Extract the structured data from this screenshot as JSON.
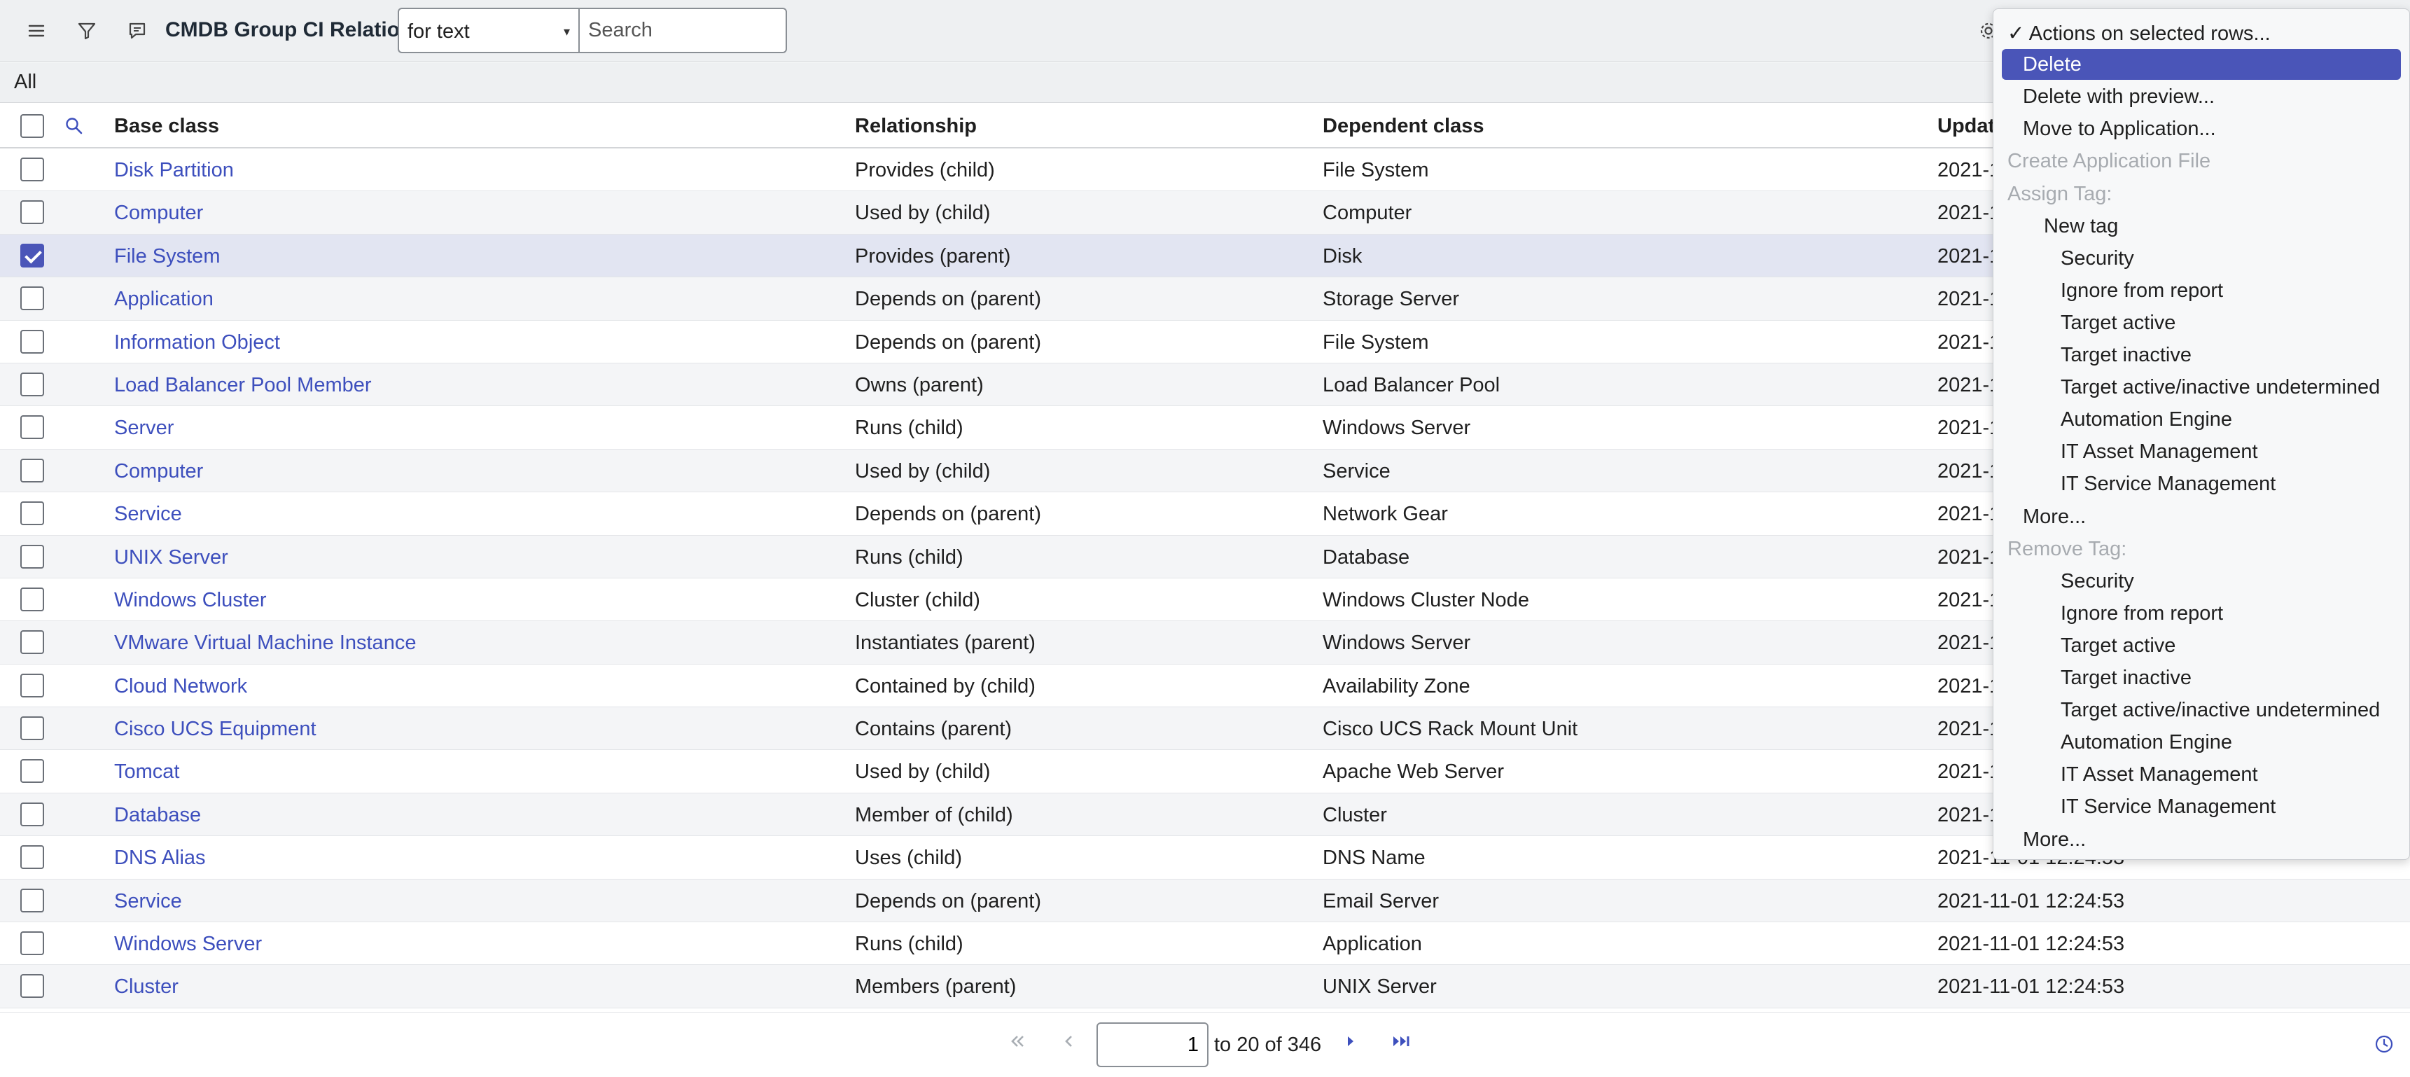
{
  "header": {
    "title": "CMDB Group CI Relations",
    "search_field": "for text",
    "search_placeholder": "Search"
  },
  "breadcrumb": "All",
  "columns": {
    "base": "Base class",
    "relationship": "Relationship",
    "dependent": "Dependent class",
    "updated": "Update"
  },
  "rows": [
    {
      "base": "Disk Partition",
      "rel": "Provides (child)",
      "dep": "File System",
      "upd": "2021-1",
      "selected": false
    },
    {
      "base": "Computer",
      "rel": "Used by (child)",
      "dep": "Computer",
      "upd": "2021-1",
      "selected": false
    },
    {
      "base": "File System",
      "rel": "Provides (parent)",
      "dep": "Disk",
      "upd": "2021-1",
      "selected": true
    },
    {
      "base": "Application",
      "rel": "Depends on (parent)",
      "dep": "Storage Server",
      "upd": "2021-1",
      "selected": false
    },
    {
      "base": "Information Object",
      "rel": "Depends on (parent)",
      "dep": "File System",
      "upd": "2021-1",
      "selected": false
    },
    {
      "base": "Load Balancer Pool Member",
      "rel": "Owns (parent)",
      "dep": "Load Balancer Pool",
      "upd": "2021-1",
      "selected": false
    },
    {
      "base": "Server",
      "rel": "Runs (child)",
      "dep": "Windows Server",
      "upd": "2021-1",
      "selected": false
    },
    {
      "base": "Computer",
      "rel": "Used by (child)",
      "dep": "Service",
      "upd": "2021-1",
      "selected": false
    },
    {
      "base": "Service",
      "rel": "Depends on (parent)",
      "dep": "Network Gear",
      "upd": "2021-1",
      "selected": false
    },
    {
      "base": "UNIX Server",
      "rel": "Runs (child)",
      "dep": "Database",
      "upd": "2021-1",
      "selected": false
    },
    {
      "base": "Windows Cluster",
      "rel": "Cluster (child)",
      "dep": "Windows Cluster Node",
      "upd": "2021-1",
      "selected": false
    },
    {
      "base": "VMware Virtual Machine Instance",
      "rel": "Instantiates (parent)",
      "dep": "Windows Server",
      "upd": "2021-1",
      "selected": false
    },
    {
      "base": "Cloud Network",
      "rel": "Contained by (child)",
      "dep": "Availability Zone",
      "upd": "2021-1",
      "selected": false
    },
    {
      "base": "Cisco UCS Equipment",
      "rel": "Contains (parent)",
      "dep": "Cisco UCS Rack Mount Unit",
      "upd": "2021-1",
      "selected": false
    },
    {
      "base": "Tomcat",
      "rel": "Used by (child)",
      "dep": "Apache Web Server",
      "upd": "2021-1",
      "selected": false
    },
    {
      "base": "Database",
      "rel": "Member of (child)",
      "dep": "Cluster",
      "upd": "2021-1",
      "selected": false
    },
    {
      "base": "DNS Alias",
      "rel": "Uses (child)",
      "dep": "DNS Name",
      "upd": "2021-11-01 12:24:53",
      "selected": false
    },
    {
      "base": "Service",
      "rel": "Depends on (parent)",
      "dep": "Email Server",
      "upd": "2021-11-01 12:24:53",
      "selected": false
    },
    {
      "base": "Windows Server",
      "rel": "Runs (child)",
      "dep": "Application",
      "upd": "2021-11-01 12:24:53",
      "selected": false
    },
    {
      "base": "Cluster",
      "rel": "Members (parent)",
      "dep": "UNIX Server",
      "upd": "2021-11-01 12:24:53",
      "selected": false
    }
  ],
  "pagination": {
    "page_value": "1",
    "range_text": "to 20 of 346"
  },
  "menu": {
    "items": [
      {
        "label": "✓ Actions on selected rows...",
        "kind": "normal",
        "indent": 0
      },
      {
        "label": "Delete",
        "kind": "highlight",
        "indent": 1
      },
      {
        "label": "Delete with preview...",
        "kind": "normal",
        "indent": 1
      },
      {
        "label": "Move to Application...",
        "kind": "normal",
        "indent": 1
      },
      {
        "label": "Create Application File",
        "kind": "disabled",
        "indent": 0
      },
      {
        "label": "Assign Tag:",
        "kind": "disabled",
        "indent": 0
      },
      {
        "label": "New tag",
        "kind": "normal",
        "indent": 2
      },
      {
        "label": "Security",
        "kind": "normal",
        "indent": 3
      },
      {
        "label": "Ignore from report",
        "kind": "normal",
        "indent": 3
      },
      {
        "label": "Target active",
        "kind": "normal",
        "indent": 3
      },
      {
        "label": "Target inactive",
        "kind": "normal",
        "indent": 3
      },
      {
        "label": "Target active/inactive undetermined",
        "kind": "normal",
        "indent": 3
      },
      {
        "label": "Automation Engine",
        "kind": "normal",
        "indent": 3
      },
      {
        "label": "IT Asset Management",
        "kind": "normal",
        "indent": 3
      },
      {
        "label": "IT Service Management",
        "kind": "normal",
        "indent": 3
      },
      {
        "label": "More...",
        "kind": "normal",
        "indent": 1
      },
      {
        "label": "Remove Tag:",
        "kind": "disabled",
        "indent": 0
      },
      {
        "label": "Security",
        "kind": "normal",
        "indent": 3
      },
      {
        "label": "Ignore from report",
        "kind": "normal",
        "indent": 3
      },
      {
        "label": "Target active",
        "kind": "normal",
        "indent": 3
      },
      {
        "label": "Target inactive",
        "kind": "normal",
        "indent": 3
      },
      {
        "label": "Target active/inactive undetermined",
        "kind": "normal",
        "indent": 3
      },
      {
        "label": "Automation Engine",
        "kind": "normal",
        "indent": 3
      },
      {
        "label": "IT Asset Management",
        "kind": "normal",
        "indent": 3
      },
      {
        "label": "IT Service Management",
        "kind": "normal",
        "indent": 3
      },
      {
        "label": "More...",
        "kind": "normal",
        "indent": 1
      }
    ]
  },
  "colors": {
    "link": "#3d4fbd",
    "accent": "#4a55b8",
    "header_bg": "#eef0f2",
    "selected_row": "#e2e5f2"
  },
  "icons": [
    "hamburger-icon",
    "filter-icon",
    "comment-icon",
    "search-icon",
    "gear-icon",
    "first-page-icon",
    "prev-page-icon",
    "next-page-icon",
    "last-page-icon",
    "clock-icon"
  ]
}
